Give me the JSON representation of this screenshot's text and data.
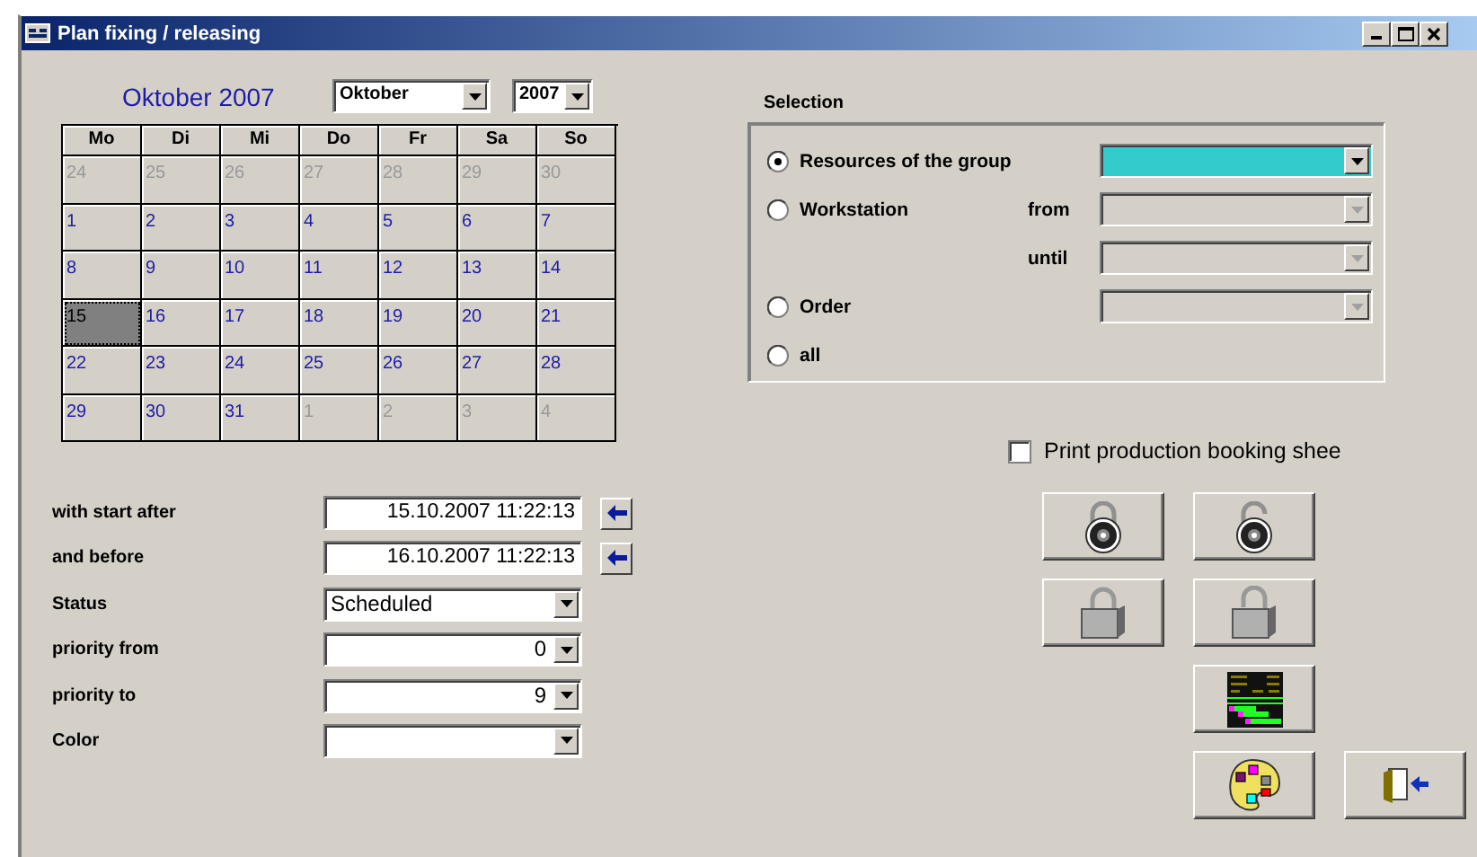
{
  "window": {
    "title": "Plan fixing / releasing"
  },
  "calendar": {
    "heading": "Oktober 2007",
    "month": "Oktober",
    "year": "2007",
    "weekdays": [
      "Mo",
      "Di",
      "Mi",
      "Do",
      "Fr",
      "Sa",
      "So"
    ],
    "weeks": [
      [
        {
          "day": "24",
          "in_month": false,
          "selected": false
        },
        {
          "day": "25",
          "in_month": false,
          "selected": false
        },
        {
          "day": "26",
          "in_month": false,
          "selected": false
        },
        {
          "day": "27",
          "in_month": false,
          "selected": false
        },
        {
          "day": "28",
          "in_month": false,
          "selected": false
        },
        {
          "day": "29",
          "in_month": false,
          "selected": false
        },
        {
          "day": "30",
          "in_month": false,
          "selected": false
        }
      ],
      [
        {
          "day": "1",
          "in_month": true,
          "selected": false
        },
        {
          "day": "2",
          "in_month": true,
          "selected": false
        },
        {
          "day": "3",
          "in_month": true,
          "selected": false
        },
        {
          "day": "4",
          "in_month": true,
          "selected": false
        },
        {
          "day": "5",
          "in_month": true,
          "selected": false
        },
        {
          "day": "6",
          "in_month": true,
          "selected": false
        },
        {
          "day": "7",
          "in_month": true,
          "selected": false
        }
      ],
      [
        {
          "day": "8",
          "in_month": true,
          "selected": false
        },
        {
          "day": "9",
          "in_month": true,
          "selected": false
        },
        {
          "day": "10",
          "in_month": true,
          "selected": false
        },
        {
          "day": "11",
          "in_month": true,
          "selected": false
        },
        {
          "day": "12",
          "in_month": true,
          "selected": false
        },
        {
          "day": "13",
          "in_month": true,
          "selected": false
        },
        {
          "day": "14",
          "in_month": true,
          "selected": false
        }
      ],
      [
        {
          "day": "15",
          "in_month": true,
          "selected": true
        },
        {
          "day": "16",
          "in_month": true,
          "selected": false
        },
        {
          "day": "17",
          "in_month": true,
          "selected": false
        },
        {
          "day": "18",
          "in_month": true,
          "selected": false
        },
        {
          "day": "19",
          "in_month": true,
          "selected": false
        },
        {
          "day": "20",
          "in_month": true,
          "selected": false
        },
        {
          "day": "21",
          "in_month": true,
          "selected": false
        }
      ],
      [
        {
          "day": "22",
          "in_month": true,
          "selected": false
        },
        {
          "day": "23",
          "in_month": true,
          "selected": false
        },
        {
          "day": "24",
          "in_month": true,
          "selected": false
        },
        {
          "day": "25",
          "in_month": true,
          "selected": false
        },
        {
          "day": "26",
          "in_month": true,
          "selected": false
        },
        {
          "day": "27",
          "in_month": true,
          "selected": false
        },
        {
          "day": "28",
          "in_month": true,
          "selected": false
        }
      ],
      [
        {
          "day": "29",
          "in_month": true,
          "selected": false
        },
        {
          "day": "30",
          "in_month": true,
          "selected": false
        },
        {
          "day": "31",
          "in_month": true,
          "selected": false
        },
        {
          "day": "1",
          "in_month": false,
          "selected": false
        },
        {
          "day": "2",
          "in_month": false,
          "selected": false
        },
        {
          "day": "3",
          "in_month": false,
          "selected": false
        },
        {
          "day": "4",
          "in_month": false,
          "selected": false
        }
      ]
    ]
  },
  "filters": [
    {
      "label": "with start after",
      "kind": "datetime",
      "value": "15.10.2007 11:22:13"
    },
    {
      "label": "and before",
      "kind": "datetime",
      "value": "16.10.2007 11:22:13"
    },
    {
      "label": "Status",
      "kind": "dropdown",
      "value": "Scheduled"
    },
    {
      "label": "priority from",
      "kind": "number",
      "value": "0"
    },
    {
      "label": "priority to",
      "kind": "number",
      "value": "9"
    },
    {
      "label": "Color",
      "kind": "dropdown"
    }
  ],
  "selection": {
    "title": "Selection",
    "options": [
      {
        "label": "Resources of the group",
        "selected": true,
        "combos": [
          {
            "enabled": true
          }
        ]
      },
      {
        "label": "Workstation",
        "selected": false,
        "combos": [
          {
            "label": "from",
            "enabled": false
          },
          {
            "label": "until",
            "enabled": false
          }
        ]
      },
      {
        "label": "Order",
        "selected": false,
        "combos": [
          {
            "enabled": false
          }
        ]
      },
      {
        "label": "all",
        "selected": false
      }
    ]
  },
  "print_sheet": {
    "label": "Print production booking shee",
    "checked": false
  },
  "actions": [
    {
      "kind": "combo-lock"
    },
    {
      "kind": "combo-unlock"
    },
    {
      "kind": "padlock"
    },
    {
      "kind": "padlock-open"
    },
    {
      "kind": "gantt"
    },
    {
      "kind": "palette"
    },
    {
      "kind": "exit"
    }
  ]
}
